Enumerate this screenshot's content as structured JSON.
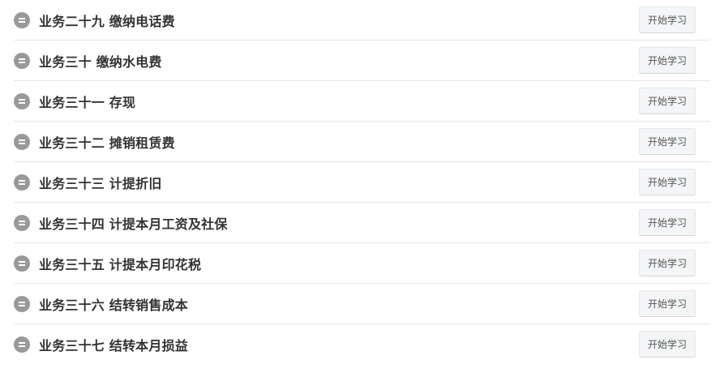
{
  "lessons": [
    {
      "title": "业务二十九 缴纳电话费",
      "button_label": "开始学习"
    },
    {
      "title": "业务三十 缴纳水电费",
      "button_label": "开始学习"
    },
    {
      "title": "业务三十一 存现",
      "button_label": "开始学习"
    },
    {
      "title": "业务三十二 摊销租赁费",
      "button_label": "开始学习"
    },
    {
      "title": "业务三十三 计提折旧",
      "button_label": "开始学习"
    },
    {
      "title": "业务三十四 计提本月工资及社保",
      "button_label": "开始学习"
    },
    {
      "title": "业务三十五 计提本月印花税",
      "button_label": "开始学习"
    },
    {
      "title": "业务三十六 结转销售成本",
      "button_label": "开始学习"
    },
    {
      "title": "业务三十七 结转本月损益",
      "button_label": "开始学习"
    }
  ],
  "row_icon": "lesson-list-icon"
}
